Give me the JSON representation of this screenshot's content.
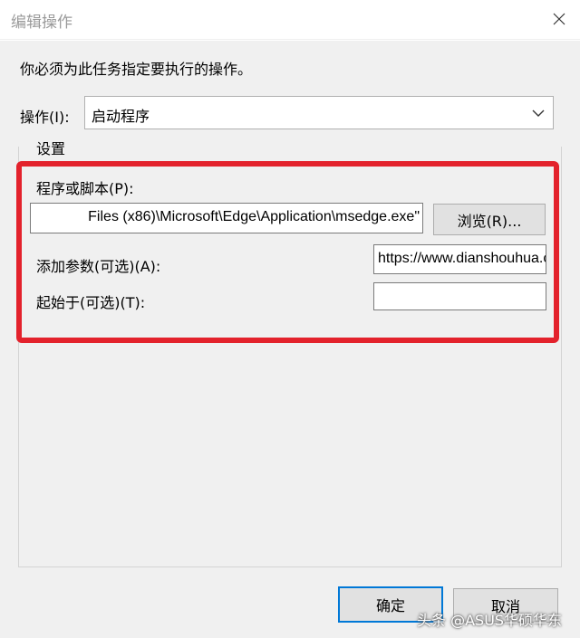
{
  "window": {
    "title": "编辑操作",
    "close_icon": "close-icon"
  },
  "instruction": "你必须为此任务指定要执行的操作。",
  "action": {
    "label": "操作(I):",
    "value": "启动程序",
    "dropdown_icon": "chevron-down-icon"
  },
  "settings": {
    "label": "设置",
    "program_label": "程序或脚本(P):",
    "program_value": "Files (x86)\\Microsoft\\Edge\\Application\\msedge.exe\"",
    "browse_label": "浏览(R)...",
    "args_label": "添加参数(可选)(A):",
    "args_value": "https://www.dianshouhua.com",
    "start_label": "起始于(可选)(T):",
    "start_value": ""
  },
  "buttons": {
    "ok": "确定",
    "cancel": "取消"
  },
  "watermark": "头条 @ASUS华硕华东",
  "colors": {
    "highlight": "#e3222c",
    "default_button_border": "#0078d7",
    "dialog_background": "#f0f0f0"
  }
}
